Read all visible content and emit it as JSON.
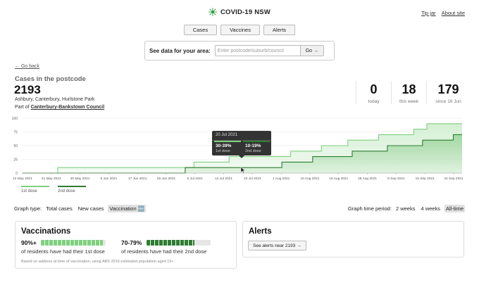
{
  "header": {
    "brand": "COVID-19 NSW",
    "links": [
      "Tip jar",
      "About site"
    ]
  },
  "nav": {
    "tabs": [
      "Cases",
      "Vaccines",
      "Alerts"
    ]
  },
  "search": {
    "label": "See data for your area:",
    "placeholder": "Enter postcode/suburb/council",
    "button": "Go →"
  },
  "area": {
    "back": "← Go back",
    "section_label": "Cases in the postcode",
    "postcode": "2193",
    "suburbs": "Ashbury, Canterbury, Hurlstone Park",
    "council_prefix": "Part of",
    "council": "Canterbury-Bankstown Council"
  },
  "stats": [
    {
      "value": "0",
      "caption": "today"
    },
    {
      "value": "18",
      "caption": "this week"
    },
    {
      "value": "179",
      "caption": "since 16 Jun"
    }
  ],
  "tooltip": {
    "date": "20 Jul 2021",
    "first_value": "30-39%",
    "first_label": "1st dose",
    "second_value": "10-19%",
    "second_label": "2nd dose"
  },
  "legend": {
    "first": "1st dose",
    "second": "2nd dose"
  },
  "controls": {
    "graph_type_label": "Graph type:",
    "graph_types": [
      "Total cases",
      "New cases",
      "Vaccination 🆕"
    ],
    "graph_type_selected": 2,
    "time_period_label": "Graph time period:",
    "time_periods": [
      "2 weeks",
      "4 weeks",
      "All-time"
    ],
    "time_period_selected": 2
  },
  "vaccinations": {
    "title": "Vaccinations",
    "first_pct": "90%+",
    "first_text": "of residents have had their 1st dose",
    "first_fill": 0.95,
    "second_pct": "70-79%",
    "second_text": "of residents have had their 2nd dose",
    "second_fill": 0.75,
    "note": "Based on address at time of vaccination, using ABS 2019 estimated population aged 15+"
  },
  "alerts": {
    "title": "Alerts",
    "button": "See alerts near 2193 →"
  },
  "colors": {
    "first_dose": "#7fd07f",
    "second_dose": "#2e7d32",
    "first_fill_area": "#cfeecf",
    "second_fill_area": "#9fd69f"
  },
  "chart_data": {
    "type": "area",
    "y_ticks": [
      "0",
      "25",
      "50",
      "75",
      "100"
    ],
    "ylim": [
      0,
      100
    ],
    "x_labels": [
      "12 May 2021",
      "21 May 2021",
      "30 May 2021",
      "8 Jun 2021",
      "17 Jun 2021",
      "26 Jun 2021",
      "5 Jul 2021",
      "14 Jul 2021",
      "23 Jul 2021",
      "1 Aug 2021",
      "10 Aug 2021",
      "19 Aug 2021",
      "28 Aug 2021",
      "6 Sep 2021",
      "15 Sep 2021",
      "24 Sep 2021"
    ],
    "series": [
      {
        "name": "1st dose",
        "points": [
          [
            0,
            0
          ],
          [
            0.08,
            0
          ],
          [
            0.08,
            10
          ],
          [
            0.14,
            10
          ],
          [
            0.14,
            10
          ],
          [
            0.39,
            10
          ],
          [
            0.39,
            20
          ],
          [
            0.47,
            20
          ],
          [
            0.47,
            30
          ],
          [
            0.61,
            30
          ],
          [
            0.61,
            40
          ],
          [
            0.68,
            40
          ],
          [
            0.68,
            50
          ],
          [
            0.74,
            50
          ],
          [
            0.74,
            60
          ],
          [
            0.81,
            60
          ],
          [
            0.81,
            70
          ],
          [
            0.89,
            70
          ],
          [
            0.89,
            80
          ],
          [
            0.92,
            80
          ],
          [
            0.92,
            90
          ],
          [
            1.0,
            90
          ]
        ]
      },
      {
        "name": "2nd dose",
        "points": [
          [
            0,
            0
          ],
          [
            0.37,
            0
          ],
          [
            0.37,
            10
          ],
          [
            0.59,
            10
          ],
          [
            0.59,
            20
          ],
          [
            0.66,
            20
          ],
          [
            0.66,
            30
          ],
          [
            0.75,
            30
          ],
          [
            0.75,
            40
          ],
          [
            0.83,
            40
          ],
          [
            0.83,
            50
          ],
          [
            0.91,
            50
          ],
          [
            0.91,
            60
          ],
          [
            0.98,
            60
          ],
          [
            0.98,
            70
          ],
          [
            1.0,
            70
          ]
        ]
      }
    ],
    "grid": true
  }
}
